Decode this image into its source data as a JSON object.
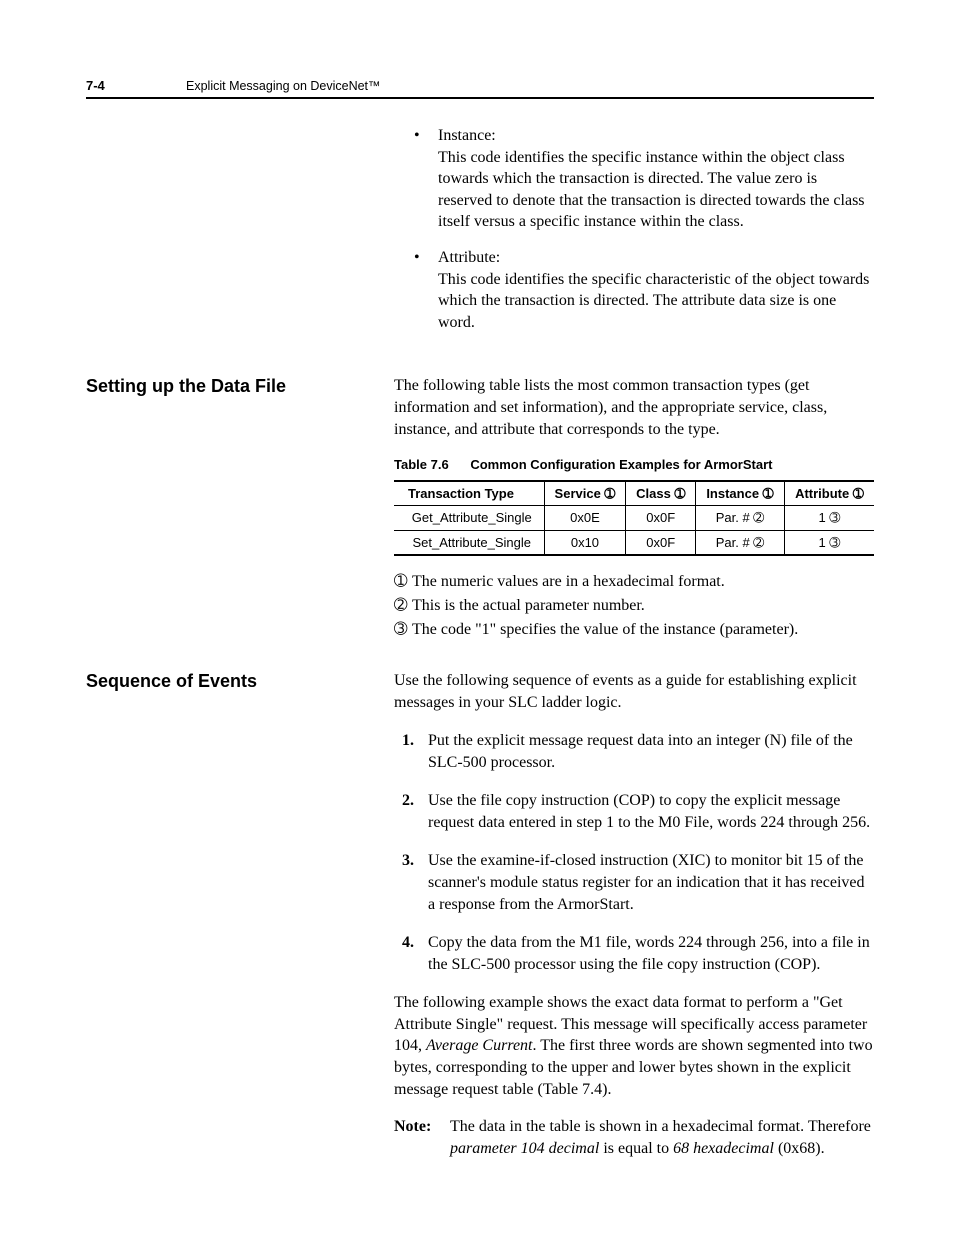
{
  "header": {
    "page_num": "7-4",
    "doc_title": "Explicit Messaging on DeviceNet™"
  },
  "definitions": {
    "instance": {
      "term": "Instance:",
      "body": "This code identifies the specific instance within the object class towards which the transaction is directed. The value zero is reserved to denote that the transaction is directed towards the class itself versus a specific instance within the class."
    },
    "attribute": {
      "term": "Attribute:",
      "body": "This code identifies the specific characteristic of the object towards which the transaction is directed. The attribute data size is one word."
    }
  },
  "section_datafile": {
    "heading": "Setting up the Data File",
    "intro": "The following table lists the most common transaction types (get information and set information), and the appropriate service, class, instance, and attribute that corresponds to the type.",
    "table": {
      "number": "Table 7.6",
      "title": "Common Configuration Examples for ArmorStart",
      "head": {
        "c1": "Transaction Type",
        "c2": "Service ➀",
        "c3": "Class ➀",
        "c4": "Instance ➀",
        "c5": "Attribute ➀"
      },
      "rows": [
        {
          "c1": "Get_Attribute_Single",
          "c2": "0x0E",
          "c3": "0x0F",
          "c4": "Par. # ➁",
          "c5": "1 ➂"
        },
        {
          "c1": "Set_Attribute_Single",
          "c2": "0x10",
          "c3": "0x0F",
          "c4": "Par. # ➁",
          "c5": "1 ➂"
        }
      ]
    },
    "footnotes": {
      "f1": {
        "sym": "➀",
        "text": "The numeric values are in a hexadecimal format."
      },
      "f2": {
        "sym": "➁",
        "text": "This is the actual parameter number."
      },
      "f3": {
        "sym": "➂",
        "text": "The code \"1\" specifies the value of the instance (parameter)."
      }
    }
  },
  "section_sequence": {
    "heading": "Sequence of Events",
    "intro": "Use the following sequence of events as a guide for establishing explicit messages in your SLC ladder logic.",
    "steps": [
      "Put the explicit message request data into an integer (N) file of the SLC-500 processor.",
      "Use the file copy instruction (COP) to copy the explicit message request data entered in step 1 to the M0 File, words 224 through 256.",
      "Use the examine-if-closed instruction (XIC) to monitor bit 15 of the scanner's module status register for an indication that it has received a response from the ArmorStart.",
      "Copy the data from the M1 file, words 224 through 256, into a file in the SLC-500 processor using the file copy instruction (COP)."
    ],
    "closing_pre": "The following example shows the exact data format to perform a \"Get Attribute Single\" request. This message will specifically access parameter 104, ",
    "closing_em": "Average Current",
    "closing_post": ". The first three words are shown segmented into two bytes, corresponding to the upper and lower bytes shown in the explicit message request table (Table 7.4).",
    "note": {
      "label": "Note:",
      "pre": "The data in the table is shown in a hexadecimal format. Therefore ",
      "em1": "parameter 104 decimal",
      "mid": " is equal to ",
      "em2": "68 hexadecimal",
      "post": " (0x68)."
    }
  },
  "chart_data": {
    "type": "table",
    "title": "Table 7.6 Common Configuration Examples for ArmorStart",
    "columns": [
      "Transaction Type",
      "Service",
      "Class",
      "Instance",
      "Attribute"
    ],
    "rows": [
      [
        "Get_Attribute_Single",
        "0x0E",
        "0x0F",
        "Par. #",
        "1"
      ],
      [
        "Set_Attribute_Single",
        "0x10",
        "0x0F",
        "Par. #",
        "1"
      ]
    ],
    "footnotes": [
      "① The numeric values are in a hexadecimal format.",
      "② This is the actual parameter number.",
      "③ The code \"1\" specifies the value of the instance (parameter)."
    ]
  }
}
